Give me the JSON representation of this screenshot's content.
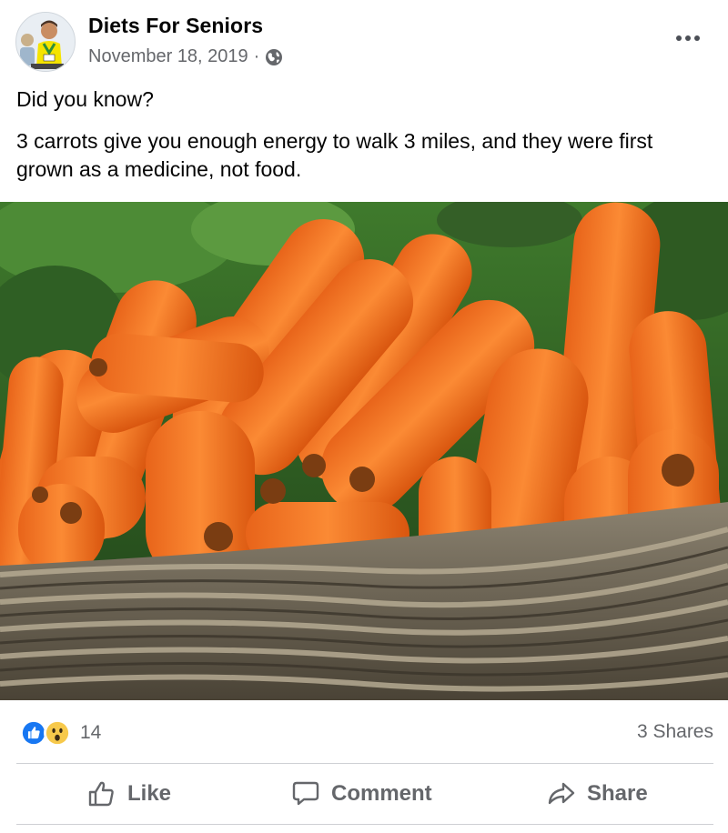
{
  "post": {
    "page_name": "Diets For Seniors",
    "date": "November 18, 2019",
    "separator": "·",
    "privacy_icon": "globe-icon",
    "more_icon": "more-options-icon",
    "text_line1": "Did you know?",
    "text_line2": "3 carrots give you enough energy to walk 3 miles, and they were first grown as a medicine, not food.",
    "photo_description_icon": "carrots-photo"
  },
  "engagement": {
    "reaction_icons": [
      "like-reaction-icon",
      "wow-reaction-icon"
    ],
    "reaction_count": "14",
    "shares": "3 Shares"
  },
  "actions": {
    "like": "Like",
    "comment": "Comment",
    "share": "Share"
  },
  "colors": {
    "text_primary": "#050505",
    "text_secondary": "#65676b",
    "like_blue": "#1877f2",
    "wow_yellow": "#f7c94b",
    "divider": "#ced0d4"
  }
}
